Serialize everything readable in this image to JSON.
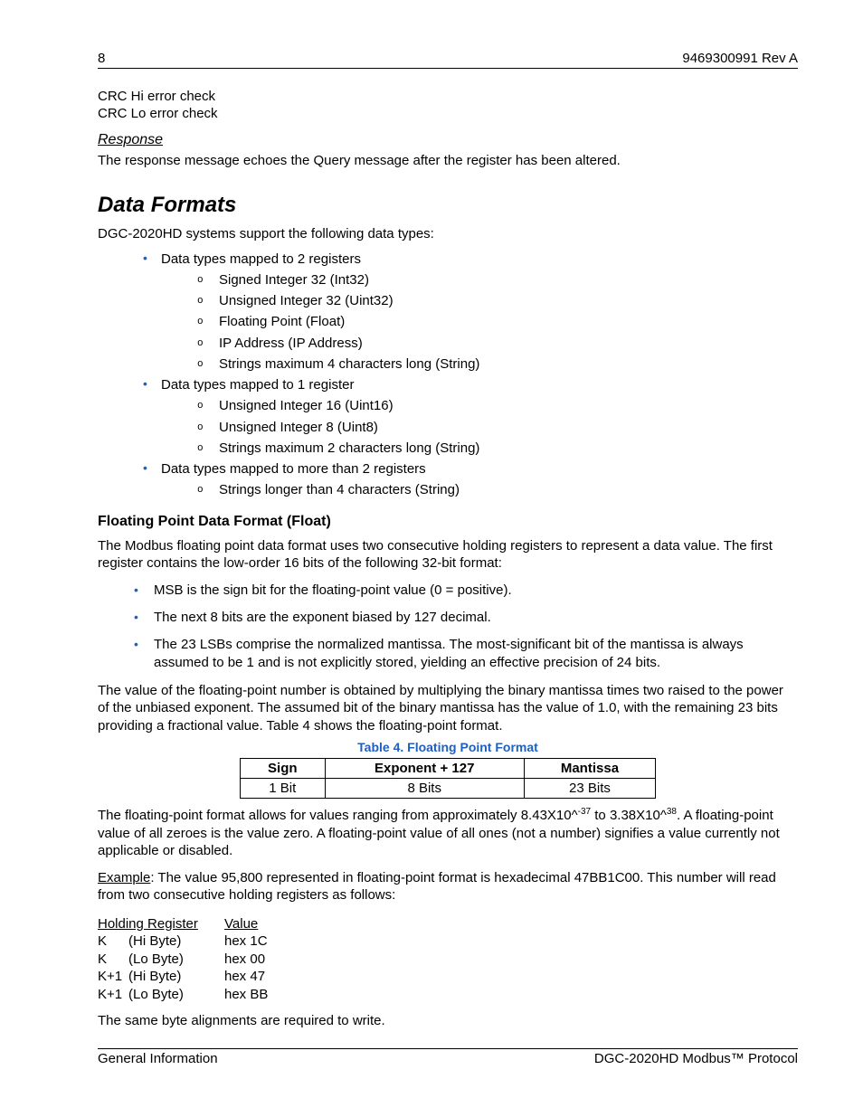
{
  "header": {
    "page_num": "8",
    "doc_rev": "9469300991 Rev A"
  },
  "crc": {
    "hi": "CRC Hi error check",
    "lo": "CRC Lo error check"
  },
  "response": {
    "heading": "Response",
    "text": "The response message echoes the Query message after the register has been altered."
  },
  "data_formats": {
    "heading": "Data Formats",
    "intro": "DGC-2020HD systems support the following data types:",
    "groups": [
      {
        "label": "Data types mapped to 2 registers",
        "items": [
          "Signed Integer 32 (Int32)",
          "Unsigned Integer 32 (Uint32)",
          "Floating Point (Float)",
          "IP Address (IP Address)",
          "Strings maximum 4 characters long (String)"
        ]
      },
      {
        "label": "Data types mapped to 1 register",
        "items": [
          "Unsigned Integer 16 (Uint16)",
          "Unsigned Integer 8 (Uint8)",
          "Strings maximum 2 characters long (String)"
        ]
      },
      {
        "label": "Data types mapped to more than 2 registers",
        "items": [
          "Strings longer than 4 characters (String)"
        ]
      }
    ]
  },
  "float_section": {
    "heading": "Floating Point Data Format (Float)",
    "p1": "The Modbus floating point data format uses two consecutive holding registers to represent a data value. The first register contains the low-order 16 bits of the following 32-bit format:",
    "bullets": [
      "MSB is the sign bit for the floating-point value (0 = positive).",
      "The next 8 bits are the exponent biased by 127 decimal.",
      "The 23 LSBs comprise the normalized mantissa. The most-significant bit of the mantissa is always assumed to be 1 and is not explicitly stored, yielding an effective precision of 24 bits."
    ],
    "p2": "The value of the floating-point number is obtained by multiplying the binary mantissa times two raised to the power of the unbiased exponent. The assumed bit of the binary mantissa has the value of 1.0, with the remaining 23 bits providing a fractional value. Table 4 shows the floating-point format.",
    "table_caption": "Table 4. Floating Point Format",
    "table": {
      "headers": [
        "Sign",
        "Exponent + 127",
        "Mantissa"
      ],
      "row": [
        "1 Bit",
        "8 Bits",
        "23 Bits"
      ]
    },
    "p3_pre": "The floating-point format allows for values ranging from approximately 8.43X10^",
    "p3_sup1": "-37",
    "p3_mid": " to  3.38X10^",
    "p3_sup2": "38",
    "p3_post": ". A floating-point value of all zeroes is the value zero. A floating-point value of all ones (not a number) signifies a value currently not applicable or disabled.",
    "example_label": "Example",
    "example_text": ": The value 95,800 represented in floating-point format is hexadecimal 47BB1C00. This number will read from two consecutive holding registers as follows:",
    "reg_header": {
      "c1": "Holding Register",
      "c2": "Value"
    },
    "reg_rows": [
      {
        "c1a": "K",
        "c1b": "(Hi Byte)",
        "c2": "hex 1C"
      },
      {
        "c1a": "K",
        "c1b": "(Lo Byte)",
        "c2": "hex 00"
      },
      {
        "c1a": "K+1",
        "c1b": "(Hi Byte)",
        "c2": "hex 47"
      },
      {
        "c1a": "K+1",
        "c1b": "(Lo Byte)",
        "c2": "hex BB"
      }
    ],
    "p4": "The same byte alignments are required to write."
  },
  "footer": {
    "left": "General Information",
    "right": "DGC-2020HD Modbus™ Protocol"
  }
}
